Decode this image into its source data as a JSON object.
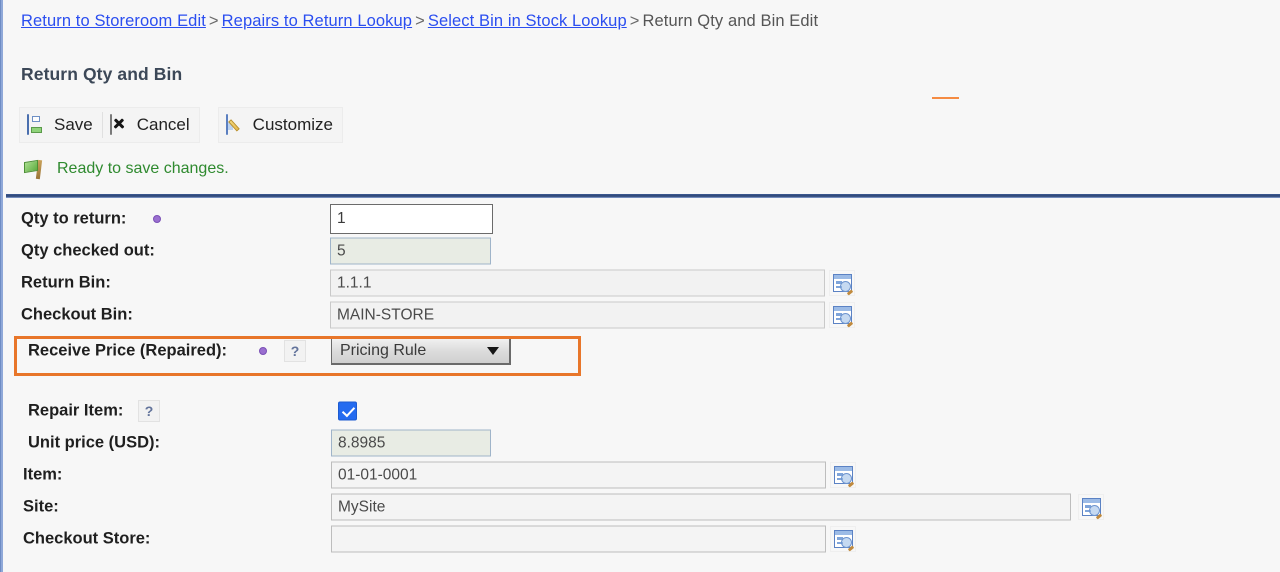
{
  "breadcrumb": {
    "items": [
      {
        "label": "Return to Storeroom Edit",
        "link": true
      },
      {
        "label": "Repairs to Return Lookup",
        "link": true
      },
      {
        "label": "Select Bin in Stock Lookup",
        "link": true
      },
      {
        "label": "Return Qty and Bin Edit",
        "link": false
      }
    ],
    "separator": ">"
  },
  "page": {
    "title": "Return Qty and Bin"
  },
  "toolbar": {
    "save_label": "Save",
    "cancel_label": "Cancel",
    "customize_label": "Customize"
  },
  "status": {
    "message": "Ready to save changes.",
    "color": "#2f8a2f"
  },
  "form": {
    "qty_to_return": {
      "label": "Qty to return:",
      "value": "1",
      "required": true,
      "editable": true
    },
    "qty_checked_out": {
      "label": "Qty checked out:",
      "value": "5",
      "required": false,
      "editable": false
    },
    "return_bin": {
      "label": "Return Bin:",
      "value": "1.1.1",
      "lookup": true
    },
    "checkout_bin": {
      "label": "Checkout Bin:",
      "value": "MAIN-STORE",
      "lookup": true
    },
    "receive_price": {
      "label": "Receive Price (Repaired):",
      "value": "Pricing Rule",
      "required": true,
      "help": "?",
      "highlighted": true,
      "highlight_color": "#e8762a"
    },
    "repair_item": {
      "label": "Repair Item:",
      "help": "?",
      "checked": true
    },
    "unit_price": {
      "label": "Unit price (USD):",
      "value": "8.8985",
      "editable": false
    },
    "item": {
      "label": "Item:",
      "value": "01-01-0001",
      "lookup": true
    },
    "site": {
      "label": "Site:",
      "value": "MySite",
      "lookup": true
    },
    "checkout_store": {
      "label": "Checkout Store:",
      "value": "",
      "lookup": true
    }
  }
}
